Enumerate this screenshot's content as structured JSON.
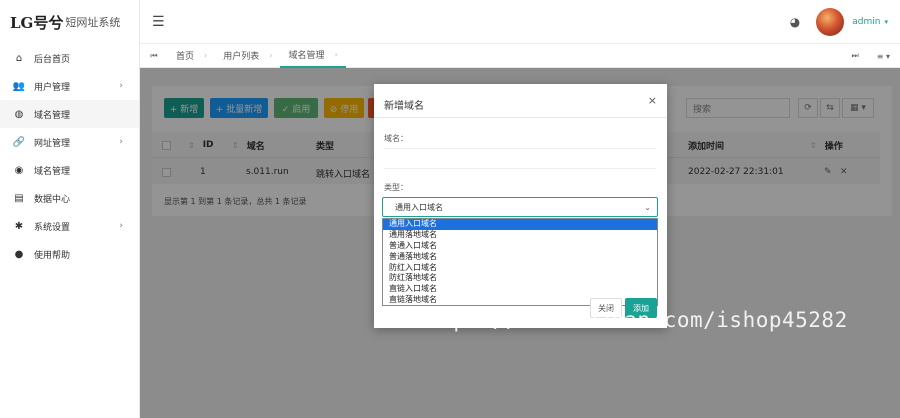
{
  "logo": {
    "main": "LG号兮",
    "sub": "短网址系统"
  },
  "sidebar": {
    "items": [
      {
        "label": "后台首页",
        "icon": "home-icon",
        "glyph": "⌂",
        "has_children": false,
        "active": false
      },
      {
        "label": "用户管理",
        "icon": "users-icon",
        "glyph": "👥",
        "has_children": true,
        "active": false
      },
      {
        "label": "域名管理",
        "icon": "globe-icon",
        "glyph": "◍",
        "has_children": false,
        "active": true
      },
      {
        "label": "网址管理",
        "icon": "link-icon",
        "glyph": "🔗",
        "has_children": true,
        "active": false
      },
      {
        "label": "域名管理",
        "icon": "eye-icon",
        "glyph": "◉",
        "has_children": false,
        "active": false
      },
      {
        "label": "数据中心",
        "icon": "database-icon",
        "glyph": "▤",
        "has_children": false,
        "active": false
      },
      {
        "label": "系统设置",
        "icon": "gear-icon",
        "glyph": "✱",
        "has_children": true,
        "active": false
      },
      {
        "label": "使用帮助",
        "icon": "info-icon",
        "glyph": "●",
        "has_children": false,
        "active": false
      }
    ],
    "chevron": "›"
  },
  "header": {
    "menu_glyph": "☰",
    "palette_glyph": "◕",
    "user": "admin",
    "caret": "▾"
  },
  "tabs": {
    "nav_glyph": "⏮",
    "items": [
      {
        "label": "首页",
        "active": false
      },
      {
        "label": "用户列表",
        "active": false
      },
      {
        "label": "域名管理",
        "active": true
      }
    ],
    "right_next": "⏭",
    "right_menu": "≡ ▾"
  },
  "toolbar": {
    "add": "+ 新增",
    "batch_add": "+ 批量新增",
    "enable": "✓ 启用",
    "disable": "⊘ 停用",
    "search_placeholder": "搜索",
    "refresh": "⟳",
    "toggle": "⇆",
    "columns": "▦ ▾"
  },
  "table": {
    "headers": {
      "id": "ID",
      "domain": "域名",
      "type": "类型",
      "added": "添加时间",
      "actions": "操作"
    },
    "sort_glyph": "⇕",
    "rows": [
      {
        "id": "1",
        "domain": "s.011.run",
        "type": "跳转入口域名",
        "added": "2022-02-27 22:31:01",
        "edit": "✎",
        "delete": "✕"
      }
    ],
    "footer": "显示第 1 到第 1 条记录，总共 1 条记录"
  },
  "modal": {
    "title": "新增域名",
    "close": "×",
    "domain_label": "域名：",
    "type_label": "类型：",
    "selected": "通用入口域名",
    "caret": "⌄",
    "options": [
      "通用入口域名",
      "通用落地域名",
      "普通入口域名",
      "普通落地域名",
      "防红入口域名",
      "防红落地域名",
      "直链入口域名",
      "直链落地域名"
    ],
    "close_button": "关闭",
    "submit_button": "添加"
  },
  "colors": {
    "accent": "#1aa394",
    "blue": "#1e9fff",
    "orange": "#ffb800",
    "red": "#ff5722",
    "selected_option": "#1e6fe0"
  },
  "watermark": "https://www.huzhan.com/ishop45282"
}
